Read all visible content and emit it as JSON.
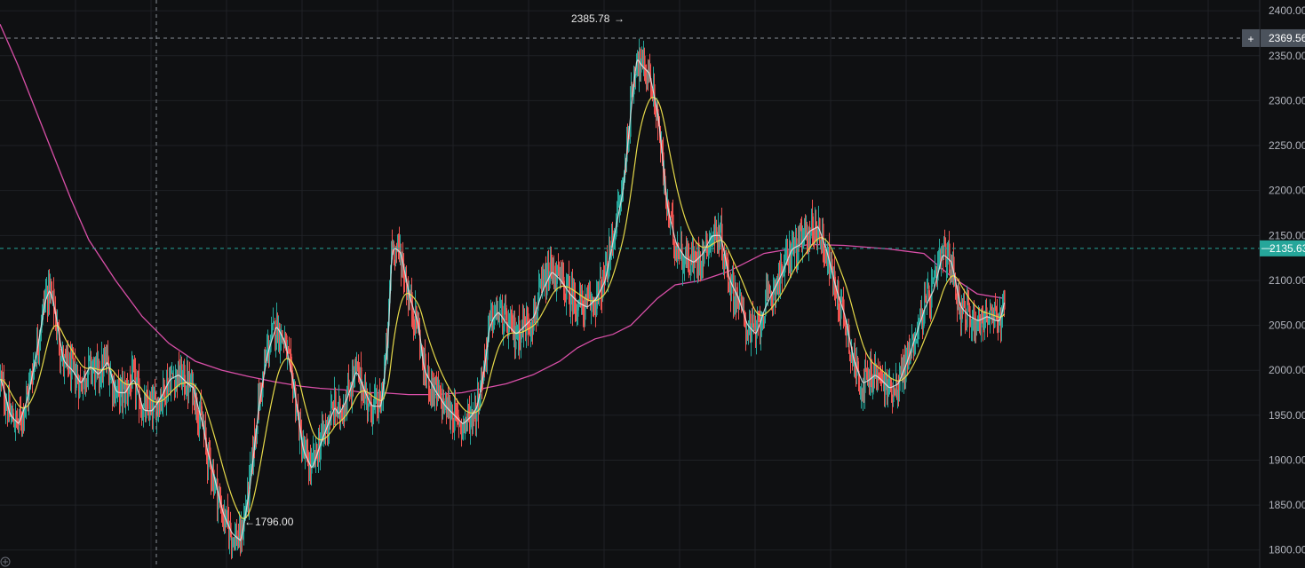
{
  "chart_data": {
    "type": "candlestick",
    "y_axis": {
      "ticks": [
        "2400.00",
        "2350.00",
        "2300.00",
        "2250.00",
        "2200.00",
        "2150.00",
        "2100.00",
        "2050.00",
        "2000.00",
        "1950.00",
        "1900.00",
        "1850.00",
        "1800.00"
      ],
      "ylim": [
        1780,
        2412
      ],
      "position": "right",
      "grid": true
    },
    "x_axis": {
      "grid": true,
      "labels_visible": false
    },
    "annotations": {
      "high": {
        "label": "2385.78",
        "arrow": "→",
        "value": 2385.78
      },
      "low": {
        "label": "1796.00",
        "arrow": "←",
        "value": 1796.0
      }
    },
    "price_lines": {
      "crosshair": {
        "label": "2369.56",
        "value": 2369.56,
        "color": "#5d6672",
        "plus": "+"
      },
      "last_price": {
        "label": "2135.63",
        "value": 2135.63,
        "color": "#26a69a",
        "dash": "—"
      }
    },
    "colors": {
      "up": "#26a69a",
      "down": "#ef5350",
      "ma_fast": "#e8e8e8",
      "ma_mid": "#e6d94a",
      "ma_slow": "#d94fa8",
      "grid": "#1f2125"
    },
    "series": [
      {
        "kind": "price_path",
        "x_bars": [
          0,
          10,
          20,
          30,
          40,
          50,
          55,
          60,
          70,
          80,
          90,
          100,
          110,
          120,
          125,
          130,
          135,
          140,
          145,
          150,
          156,
          160,
          170,
          180,
          190,
          200,
          210,
          217,
          220,
          228,
          232,
          235,
          240,
          245,
          250,
          260,
          270,
          280,
          290,
          300,
          310,
          320,
          330,
          340,
          350,
          360,
          368,
          376,
          380,
          390,
          400,
          410,
          417,
          428,
          436,
          440,
          450,
          460,
          470,
          476,
          490,
          500,
          510,
          520,
          530,
          536,
          541,
          545,
          550,
          555,
          560,
          570,
          580,
          590,
          600,
          610,
          620,
          630,
          640,
          650,
          660,
          670,
          680,
          690,
          700,
          706,
          712,
          716,
          720,
          730,
          740,
          750,
          760,
          770,
          780,
          790,
          800,
          810,
          820,
          830,
          840,
          850,
          860,
          870,
          880,
          890,
          900,
          910,
          920,
          930,
          940,
          950,
          960,
          970,
          978,
          984,
          990,
          1000,
          1010,
          1020,
          1030,
          1040,
          1050,
          1060,
          1070,
          1080,
          1090,
          1100,
          1110,
          1120,
          1124,
          1127,
          1130
        ],
        "values": [
          1990,
          1950,
          1940,
          1970,
          2020,
          2080,
          2090,
          2070,
          2010,
          2000,
          1985,
          2005,
          1995,
          2010,
          1990,
          1975,
          1975,
          1975,
          1985,
          1990,
          1970,
          1955,
          1955,
          1970,
          1990,
          1995,
          1985,
          1980,
          1965,
          1935,
          1910,
          1900,
          1880,
          1860,
          1840,
          1818,
          1810,
          1870,
          1960,
          2020,
          2050,
          2030,
          1980,
          1910,
          1890,
          1920,
          1940,
          1960,
          1950,
          1970,
          2000,
          1975,
          1960,
          1960,
          2040,
          2140,
          2130,
          2080,
          2050,
          2000,
          1975,
          1960,
          1950,
          1940,
          1950,
          1960,
          1985,
          2010,
          2050,
          2060,
          2065,
          2050,
          2040,
          2050,
          2060,
          2090,
          2110,
          2100,
          2085,
          2075,
          2070,
          2080,
          2100,
          2150,
          2200,
          2260,
          2320,
          2350,
          2340,
          2330,
          2280,
          2180,
          2140,
          2125,
          2120,
          2130,
          2150,
          2150,
          2100,
          2080,
          2050,
          2040,
          2070,
          2090,
          2110,
          2135,
          2140,
          2155,
          2160,
          2130,
          2090,
          2060,
          2010,
          1985,
          1990,
          1995,
          1990,
          1980,
          1985,
          2010,
          2040,
          2070,
          2090,
          2130,
          2120,
          2070,
          2060,
          2055,
          2060,
          2055,
          2055,
          2065,
          2080,
          2110,
          2135
        ]
      },
      {
        "name": "",
        "kind": "ma_fast",
        "smoothing": 3
      },
      {
        "name": "",
        "kind": "ma_mid",
        "smoothing": 10
      },
      {
        "name": "",
        "kind": "ma_slow",
        "x_bars": [
          0,
          20,
          40,
          60,
          80,
          100,
          130,
          160,
          190,
          220,
          250,
          280,
          310,
          340,
          360,
          390,
          410,
          430,
          460,
          490,
          520,
          545,
          570,
          600,
          630,
          650,
          670,
          690,
          710,
          740,
          760,
          790,
          820,
          860,
          890,
          910,
          950,
          1000,
          1040,
          1070,
          1100,
          1130
        ],
        "values": [
          2385,
          2340,
          2290,
          2240,
          2190,
          2145,
          2100,
          2060,
          2030,
          2010,
          2000,
          1993,
          1987,
          1982,
          1980,
          1978,
          1975,
          1975,
          1973,
          1973,
          1975,
          1980,
          1985,
          1995,
          2010,
          2025,
          2035,
          2040,
          2050,
          2080,
          2095,
          2100,
          2110,
          2130,
          2135,
          2140,
          2139,
          2135,
          2130,
          2105,
          2085,
          2080
        ]
      }
    ]
  }
}
